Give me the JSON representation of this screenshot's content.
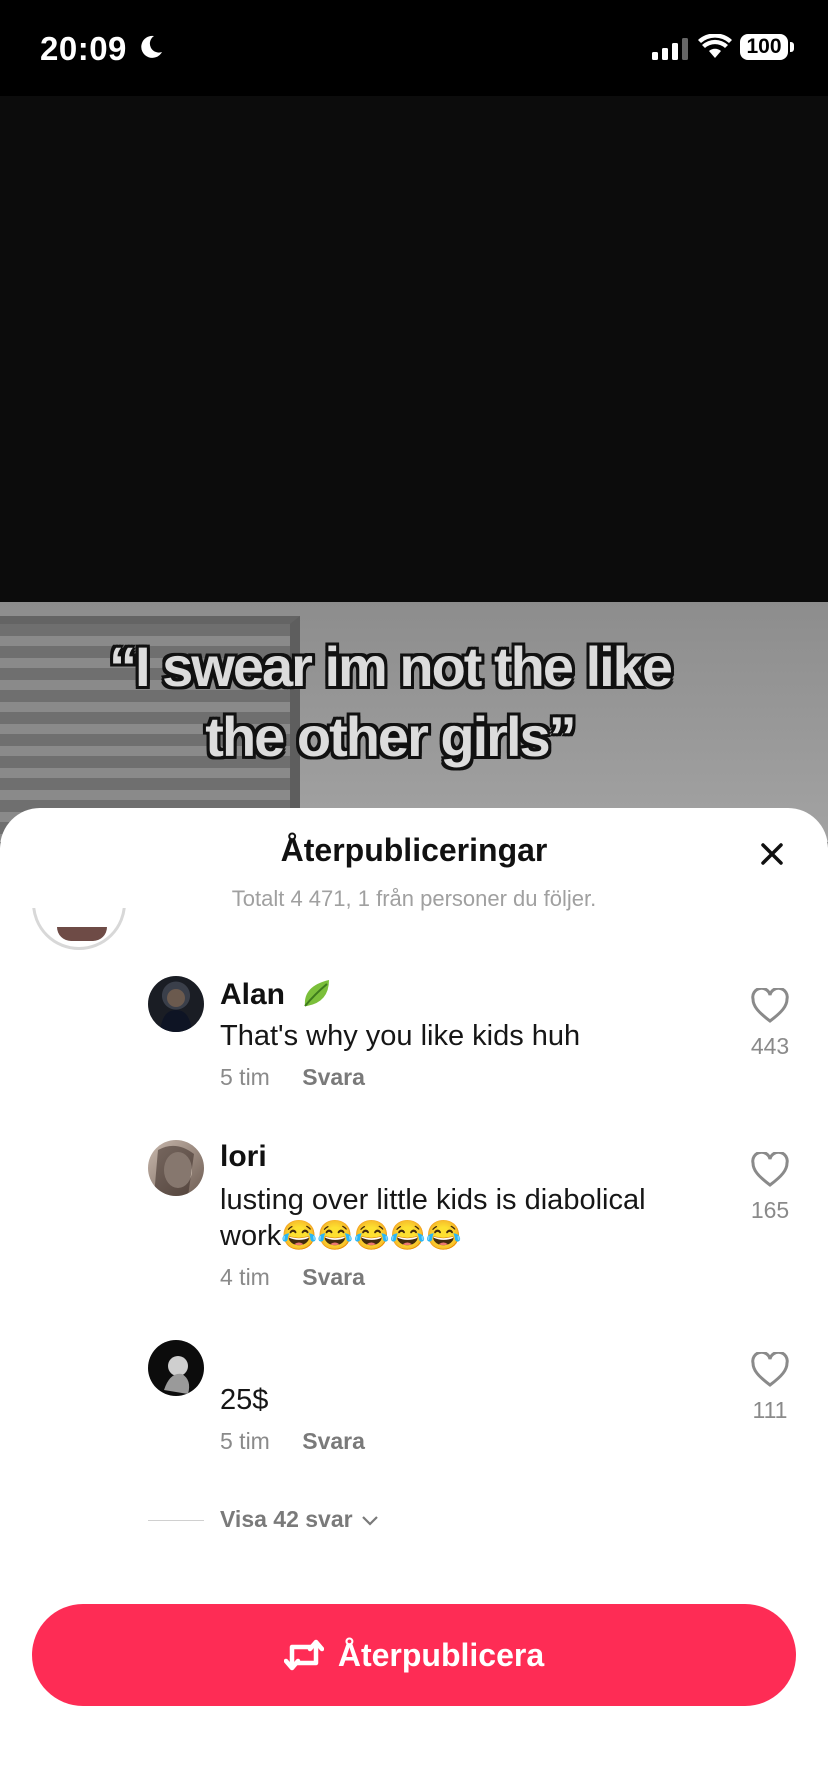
{
  "status_bar": {
    "time": "20:09",
    "battery": "100"
  },
  "video": {
    "caption_line1": "“I swear im not the like",
    "caption_line2": "the other girls”"
  },
  "sheet": {
    "title": "Återpubliceringar",
    "subtitle": "Totalt 4 471, 1 från personer du följer."
  },
  "comments": [
    {
      "name": "Alan",
      "text": "That's why you like kids huh",
      "time": "5 tim",
      "reply": "Svara",
      "likes": "443"
    },
    {
      "name": "lori",
      "text": "lusting over little kids is diabolical work😂😂😂😂😂",
      "time": "4 tim",
      "reply": "Svara",
      "likes": "165"
    },
    {
      "name": "",
      "text": "25$",
      "time": "5 tim",
      "reply": "Svara",
      "likes": "111"
    }
  ],
  "show_replies": "Visa 42 svar",
  "repost_button": "Återpublicera",
  "colors": {
    "accent": "#fe2c55"
  }
}
